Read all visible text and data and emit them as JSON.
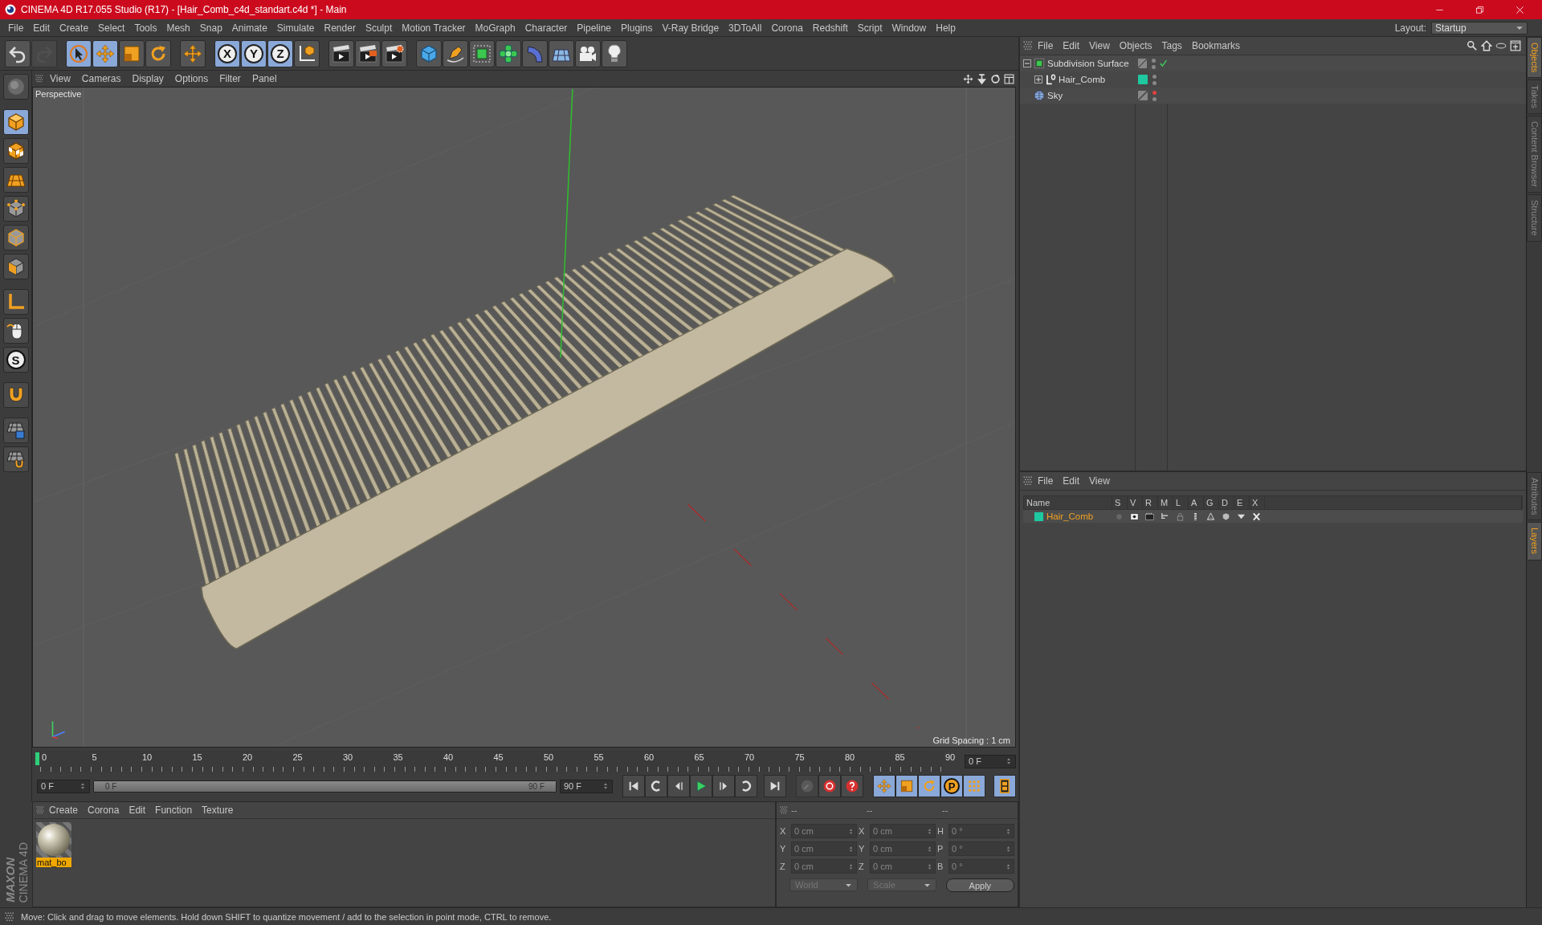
{
  "window": {
    "title": "CINEMA 4D R17.055 Studio (R17) - [Hair_Comb_c4d_standart.c4d *] - Main"
  },
  "menu": [
    "File",
    "Edit",
    "Create",
    "Select",
    "Tools",
    "Mesh",
    "Snap",
    "Animate",
    "Simulate",
    "Render",
    "Sculpt",
    "Motion Tracker",
    "MoGraph",
    "Character",
    "Pipeline",
    "Plugins",
    "V-Ray Bridge",
    "3DToAll",
    "Corona",
    "Redshift",
    "Script",
    "Window",
    "Help"
  ],
  "layout": {
    "label": "Layout:",
    "value": "Startup"
  },
  "toolbar": [
    {
      "kind": "undo",
      "selected": false,
      "disabled": false
    },
    {
      "kind": "redo",
      "selected": false,
      "disabled": true
    },
    {
      "kind": "select",
      "selected": true,
      "disabled": false
    },
    {
      "kind": "move",
      "selected": true,
      "disabled": false
    },
    {
      "kind": "scale",
      "selected": false,
      "disabled": false
    },
    {
      "kind": "rotate",
      "selected": false,
      "disabled": false
    },
    {
      "kind": "transform",
      "selected": false,
      "disabled": false
    },
    {
      "kind": "axis",
      "label": "X",
      "selected": true,
      "disabled": false
    },
    {
      "kind": "axis",
      "label": "Y",
      "selected": true,
      "disabled": false
    },
    {
      "kind": "axis",
      "label": "Z",
      "selected": true,
      "disabled": false
    },
    {
      "kind": "coords",
      "selected": false,
      "disabled": false
    },
    {
      "kind": "render_view",
      "selected": false,
      "disabled": false
    },
    {
      "kind": "render_picture",
      "selected": false,
      "disabled": false
    },
    {
      "kind": "render_settings",
      "selected": false,
      "disabled": false
    },
    {
      "kind": "cube",
      "selected": false,
      "disabled": false
    },
    {
      "kind": "pen",
      "selected": false,
      "disabled": false
    },
    {
      "kind": "subdivision",
      "selected": false,
      "disabled": false
    },
    {
      "kind": "cloner",
      "selected": false,
      "disabled": false
    },
    {
      "kind": "deformer",
      "selected": false,
      "disabled": false
    },
    {
      "kind": "floor",
      "selected": false,
      "disabled": false
    },
    {
      "kind": "camera",
      "selected": false,
      "disabled": false
    },
    {
      "kind": "light",
      "selected": false,
      "disabled": false
    }
  ],
  "side_tools": [
    {
      "kind": "sculpt",
      "selected": false
    },
    {
      "kind": "model",
      "selected": true
    },
    {
      "kind": "texture",
      "selected": false
    },
    {
      "kind": "workplane",
      "selected": false
    },
    {
      "kind": "points",
      "selected": false
    },
    {
      "kind": "edges",
      "selected": false
    },
    {
      "kind": "polygons",
      "selected": false
    },
    {
      "kind": "axis_mode",
      "selected": false
    },
    {
      "kind": "tweak",
      "selected": false
    },
    {
      "kind": "snap",
      "label": "S",
      "selected": false
    },
    {
      "kind": "magnet",
      "selected": false
    },
    {
      "kind": "lock_grid",
      "selected": false
    },
    {
      "kind": "grid_snap",
      "selected": false
    }
  ],
  "viewport": {
    "menu": [
      "View",
      "Cameras",
      "Display",
      "Options",
      "Filter",
      "Panel"
    ],
    "camera": "Perspective",
    "grid_spacing": "Grid Spacing : 1 cm"
  },
  "timeline": {
    "ticks": [
      "0",
      "5",
      "10",
      "15",
      "20",
      "25",
      "30",
      "35",
      "40",
      "45",
      "50",
      "55",
      "60",
      "65",
      "70",
      "75",
      "80",
      "85",
      "90"
    ],
    "current_frame": "0 F",
    "start": "0 F",
    "range_start": "0 F",
    "range_end": "90 F",
    "range_bar": {
      "level": 1
    },
    "end": "90 F",
    "transport": [
      {
        "kind": "first"
      },
      {
        "kind": "prev_key"
      },
      {
        "kind": "prev_frame"
      },
      {
        "kind": "play"
      },
      {
        "kind": "next_frame"
      },
      {
        "kind": "next_key"
      },
      {
        "kind": "last"
      }
    ],
    "record": [
      {
        "kind": "autokey",
        "disabled": true
      },
      {
        "kind": "record",
        "disabled": false
      },
      {
        "kind": "record_help",
        "disabled": false
      }
    ],
    "tracks": [
      {
        "kind": "position",
        "selected": true
      },
      {
        "kind": "scale",
        "selected": true
      },
      {
        "kind": "rotation",
        "selected": true
      },
      {
        "kind": "parameter",
        "label": "P",
        "selected": true
      },
      {
        "kind": "point_level",
        "selected": true
      },
      {
        "kind": "timeline",
        "selected": true
      }
    ]
  },
  "materials": {
    "menu": [
      "Create",
      "Corona",
      "Edit",
      "Function",
      "Texture"
    ],
    "items": [
      {
        "name": "mat_bo",
        "selected": true
      }
    ],
    "brand": [
      "MAXON",
      "CINEMA 4D"
    ]
  },
  "coordinates": {
    "headers": [
      "--",
      "--",
      "--"
    ],
    "rows": [
      [
        {
          "label": "X",
          "value": "0 cm"
        },
        {
          "label": "X",
          "value": "0 cm"
        },
        {
          "label": "H",
          "value": "0 °"
        }
      ],
      [
        {
          "label": "Y",
          "value": "0 cm"
        },
        {
          "label": "Y",
          "value": "0 cm"
        },
        {
          "label": "P",
          "value": "0 °"
        }
      ],
      [
        {
          "label": "Z",
          "value": "0 cm"
        },
        {
          "label": "Z",
          "value": "0 cm"
        },
        {
          "label": "B",
          "value": "0 °"
        }
      ]
    ],
    "mode": "World",
    "transform": "Scale",
    "apply": "Apply"
  },
  "objects": {
    "menu": [
      "File",
      "Edit",
      "View",
      "Objects",
      "Tags",
      "Bookmarks"
    ],
    "items": [
      {
        "kind": "subdivision",
        "name": "Subdivision Surface",
        "expanded": true,
        "enabled": true,
        "editor_visible": true,
        "children": [
          {
            "kind": "null",
            "name": "Hair_Comb",
            "expanded": false,
            "enabled": false,
            "editor_visible": true,
            "color": "#1ec8a0"
          }
        ]
      },
      {
        "kind": "sky",
        "name": "Sky",
        "enabled": false,
        "editor_visible": false
      }
    ]
  },
  "layers": {
    "menu": [
      "File",
      "Edit",
      "View"
    ],
    "columns": [
      "Name",
      "S",
      "V",
      "R",
      "M",
      "L",
      "A",
      "G",
      "D",
      "E",
      "X"
    ],
    "items": [
      {
        "name": "Hair_Comb",
        "color": "#1ec8a0",
        "toggles": [
          {
            "kind": "solo",
            "on": false
          },
          {
            "kind": "visible",
            "on": true
          },
          {
            "kind": "render",
            "on": true
          },
          {
            "kind": "manager",
            "on": true
          },
          {
            "kind": "locked",
            "on": false
          },
          {
            "kind": "animation",
            "on": true
          },
          {
            "kind": "generators",
            "on": true
          },
          {
            "kind": "deformers",
            "on": true
          },
          {
            "kind": "expressions",
            "on": true
          },
          {
            "kind": "xrefs",
            "on": true
          }
        ]
      }
    ]
  },
  "side_tabs": {
    "upper": [
      {
        "label": "Objects",
        "selected": true
      },
      {
        "label": "Takes",
        "selected": false
      },
      {
        "label": "Content Browser",
        "selected": false
      },
      {
        "label": "Structure",
        "selected": false
      }
    ],
    "lower": [
      {
        "label": "Attributes",
        "selected": false
      },
      {
        "label": "Layers",
        "selected": true
      }
    ]
  },
  "status_bar": "Move: Click and drag to move elements. Hold down SHIFT to quantize movement / add to the selection in point mode, CTRL to remove."
}
